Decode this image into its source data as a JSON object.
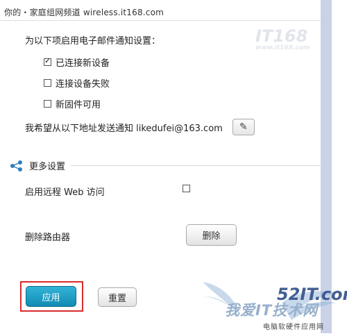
{
  "watermark": {
    "top_text": "你的・家庭组网频道 wireless.it168.com",
    "top_logo": "IT168",
    "top_logo_sub": "www.it168.com",
    "bottom_main": "我爱IT技术网",
    "bottom_logo": "52IT.com",
    "bottom_sub": "电脑软硬件应用网"
  },
  "email": {
    "heading": "为以下项启用电子邮件通知设置：",
    "options": [
      {
        "label": "已连接新设备",
        "checked": true
      },
      {
        "label": "连接设备失败",
        "checked": false
      },
      {
        "label": "新固件可用",
        "checked": false
      }
    ],
    "notify_label": "我希望从以下地址发送通知 likedufei@163.com"
  },
  "more": {
    "title": "更多设置",
    "remote_label": "启用远程 Web 访问",
    "remote_checked": false,
    "delete_label": "删除路由器",
    "delete_button": "删除"
  },
  "actions": {
    "apply": "应用",
    "reset": "重置"
  },
  "icons": {
    "edit": "pencil-icon",
    "share": "share-icon"
  },
  "colors": {
    "apply_bg": "#1b9ac8",
    "highlight": "#d92b2b",
    "rail": "#c9d2e6"
  }
}
